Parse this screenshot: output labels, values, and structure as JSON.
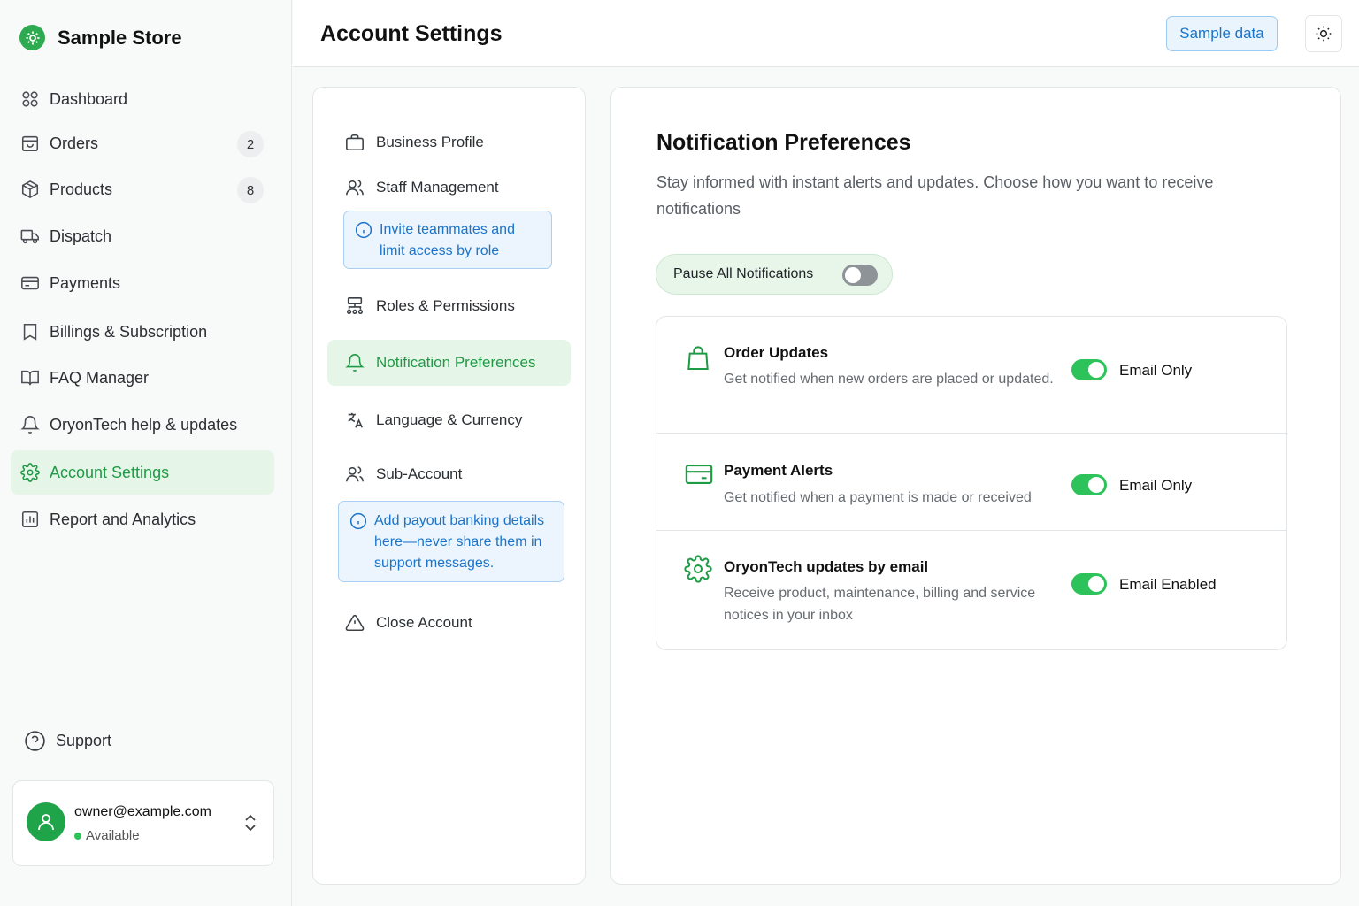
{
  "brand": {
    "name": "Sample Store"
  },
  "sidebar": {
    "items": [
      {
        "label": "Dashboard",
        "icon": "dashboard-icon"
      },
      {
        "label": "Orders",
        "icon": "orders-icon",
        "badge": "2"
      },
      {
        "label": "Products",
        "icon": "box-icon",
        "badge": "8"
      },
      {
        "label": "Dispatch",
        "icon": "truck-icon"
      },
      {
        "label": "Payments",
        "icon": "card-icon"
      },
      {
        "label": "Billings & Subscription",
        "icon": "bookmark-icon"
      },
      {
        "label": "FAQ Manager",
        "icon": "book-icon"
      },
      {
        "label": "OryonTech help & updates",
        "icon": "bell-icon"
      },
      {
        "label": "Account Settings",
        "icon": "gear-icon",
        "active": true
      },
      {
        "label": "Report and Analytics",
        "icon": "chart-icon"
      }
    ],
    "support": "Support",
    "user": {
      "email": "owner@example.com",
      "status": "Available"
    }
  },
  "header": {
    "title": "Account Settings",
    "sample_button": "Sample data",
    "theme_icon": "sun-icon"
  },
  "settings_menu": {
    "items": [
      {
        "label": "Business Profile",
        "icon": "briefcase-icon"
      },
      {
        "label": "Staff Management",
        "icon": "users-icon"
      },
      {
        "label": "Roles & Permissions",
        "icon": "hierarchy-icon"
      },
      {
        "label": "Notification Preferences",
        "icon": "bell-icon",
        "active": true
      },
      {
        "label": "Language & Currency",
        "icon": "translate-icon"
      },
      {
        "label": "Sub-Account",
        "icon": "users-icon"
      },
      {
        "label": "Close Account",
        "icon": "warning-icon"
      }
    ],
    "staff_tip": "Invite teammates and limit access by role",
    "payout_tip": "Add payout banking details here—never share them in support messages."
  },
  "content": {
    "title": "Notification Preferences",
    "description": "Stay informed with instant alerts and updates. Choose how you want to receive notifications",
    "pause_label": "Pause All Notifications",
    "pause_enabled": false,
    "rows": [
      {
        "title": "Order Updates",
        "desc": "Get notified when new orders are placed or updated.",
        "status": "Email Only",
        "icon": "shopping-bag-icon",
        "enabled": true
      },
      {
        "title": "Payment Alerts",
        "desc": "Get notified when a payment is made or received",
        "status": "Email Only",
        "icon": "credit-card-icon",
        "enabled": true
      },
      {
        "title": "OryonTech updates by email",
        "desc": "Receive product, maintenance, billing and service notices in your inbox",
        "status": "Email Enabled",
        "icon": "gear-icon",
        "enabled": true
      }
    ]
  },
  "colors": {
    "accent": "#1f9a45",
    "toggle_on": "#2ec35a",
    "info_blue": "#1b74c9"
  }
}
